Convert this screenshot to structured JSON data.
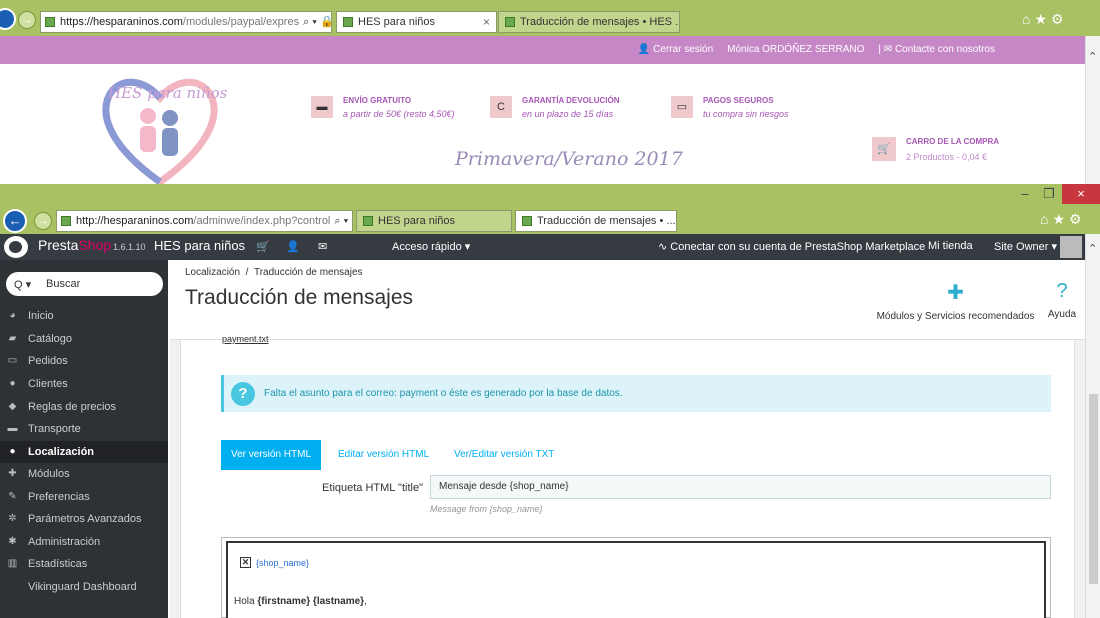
{
  "back_window": {
    "address": {
      "host": "https://hesparaninos.com",
      "path": "/modules/paypal/expres"
    },
    "tabs": [
      {
        "label": "HES para niños",
        "active": true,
        "close": "×"
      },
      {
        "label": "Traducción de mensajes • HES ...",
        "active": false
      }
    ],
    "shop_topbar": {
      "logout": "Cerrar sesión",
      "user": "Mónica ORDÓÑEZ SERRANO",
      "contact": "Contacte con nosotros"
    },
    "logo_text": "HES para niños",
    "features": [
      {
        "icon": "truck-icon",
        "title": "ENVÍO GRATUITO",
        "subtitle": "a partir de 50€ (resto 4,50€)"
      },
      {
        "icon": "refresh-icon",
        "title": "GARANTÍA DEVOLUCIÓN",
        "subtitle": "en un plazo de 15 días"
      },
      {
        "icon": "credit-card-icon",
        "title": "PAGOS SEGUROS",
        "subtitle": "tu compra sin riesgos"
      }
    ],
    "season": "Primavera/Verano 2017",
    "cart": {
      "title": "CARRO DE LA COMPRA",
      "summary": "2 Productos - 0,04 €"
    }
  },
  "front_window": {
    "address": {
      "host": "http://hesparaninos.com",
      "path": "/adminwe/index.php?control"
    },
    "tabs": [
      {
        "label": "HES para niños",
        "active": false
      },
      {
        "label": "Traducción de mensajes • ...",
        "active": true,
        "close": "×"
      }
    ],
    "window_buttons": {
      "minimize": "–",
      "restore": "❐",
      "close": "×"
    }
  },
  "ps_header": {
    "brand_a": "Presta",
    "brand_b": "Shop",
    "version": "1.6.1.10",
    "shop_name": "HES para niños",
    "quick_access": "Acceso rápido ▾",
    "marketplace": "Conectar con su cuenta de PrestaShop Marketplace",
    "my_shop": "Mi tienda",
    "owner": "Site Owner ▾"
  },
  "sidebar": {
    "search_placeholder": "Buscar",
    "items": [
      {
        "label": "Inicio",
        "icon": "dashboard-icon"
      },
      {
        "label": "Catálogo",
        "icon": "book-icon"
      },
      {
        "label": "Pedidos",
        "icon": "credit-card-icon"
      },
      {
        "label": "Clientes",
        "icon": "users-icon"
      },
      {
        "label": "Reglas de precios",
        "icon": "tag-icon"
      },
      {
        "label": "Transporte",
        "icon": "truck-icon"
      },
      {
        "label": "Localización",
        "icon": "globe-icon",
        "active": true
      },
      {
        "label": "Módulos",
        "icon": "puzzle-icon"
      },
      {
        "label": "Preferencias",
        "icon": "wrench-icon"
      },
      {
        "label": "Parámetros Avanzados",
        "icon": "cogs-icon"
      },
      {
        "label": "Administración",
        "icon": "gear-icon"
      },
      {
        "label": "Estadísticas",
        "icon": "bar-chart-icon"
      },
      {
        "label": "Vikinguard Dashboard",
        "icon": ""
      }
    ]
  },
  "page": {
    "breadcrumb": [
      "Localización",
      "/",
      "Traducción de mensajes"
    ],
    "title": "Traducción de mensajes",
    "toolbar": {
      "modules": "Módulos y Servicios recomendados",
      "help": "Ayuda"
    },
    "partial_link": "payment.txt",
    "alert": "Falta el asunto para el correo: payment o éste es generado por la base de datos.",
    "tabs": [
      "Ver versión HTML",
      "Editar versión HTML",
      "Ver/Editar versión TXT"
    ],
    "title_label": "Etiqueta HTML \"title\"",
    "title_value": "Mensaje desde {shop_name}",
    "title_help": "Message from {shop_name}",
    "preview": {
      "shop_name": "{shop_name}",
      "greeting_prefix": "Hola ",
      "greeting_vars": "{firstname} {lastname}",
      "greeting_suffix": ","
    }
  },
  "colors": {
    "accent": "#00aff0",
    "brand": "#df0067",
    "shop_purple": "#c587c6",
    "ie_green": "#a8c163"
  }
}
